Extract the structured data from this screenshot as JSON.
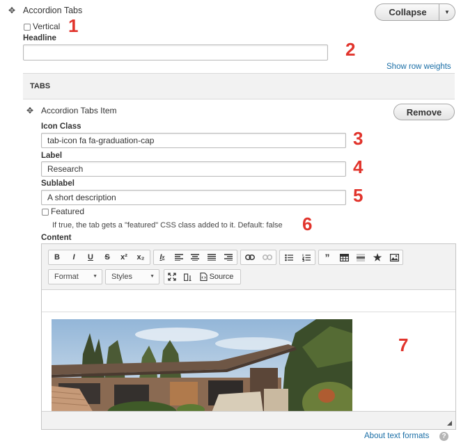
{
  "header": {
    "title": "Accordion Tabs",
    "collapse_label": "Collapse",
    "dropdown_icon": "caret-down-icon"
  },
  "vertical": {
    "label": "Vertical",
    "checked": false
  },
  "headline": {
    "label": "Headline",
    "value": ""
  },
  "show_row_weights": "Show row weights",
  "tabs_header": "TABS",
  "tab_item": {
    "title": "Accordion Tabs Item",
    "remove_label": "Remove",
    "icon_class": {
      "label": "Icon Class",
      "value": "tab-icon fa fa-graduation-cap"
    },
    "label": {
      "label": "Label",
      "value": "Research"
    },
    "sublabel": {
      "label": "Sublabel",
      "value": "A short description"
    },
    "featured": {
      "label": "Featured",
      "checked": false,
      "description": "If true, the tab gets a \"featured\" CSS class added to it. Default: false"
    },
    "content_label": "Content"
  },
  "editor": {
    "toolbar_row1": [
      [
        "B",
        "I",
        "U",
        "S",
        "x²",
        "x₂"
      ],
      [
        "Ix",
        "align-left",
        "align-center",
        "align-justify",
        "align-right"
      ],
      [
        "link",
        "unlink"
      ],
      [
        "bulleted-list",
        "numbered-list"
      ],
      [
        "blockquote",
        "table",
        "horizontal-rule",
        "star",
        "image"
      ]
    ],
    "format_label": "Format",
    "styles_label": "Styles",
    "source_label": "Source"
  },
  "annotations": [
    "1",
    "2",
    "3",
    "4",
    "5",
    "6",
    "7"
  ],
  "footer": {
    "about_text_formats": "About text formats"
  },
  "colors": {
    "annotation_red": "#e1342c",
    "link_blue": "#1a6ea6",
    "tabs_bar": "#f2f2f2",
    "editor_toolbar": "#f2f2f2"
  }
}
